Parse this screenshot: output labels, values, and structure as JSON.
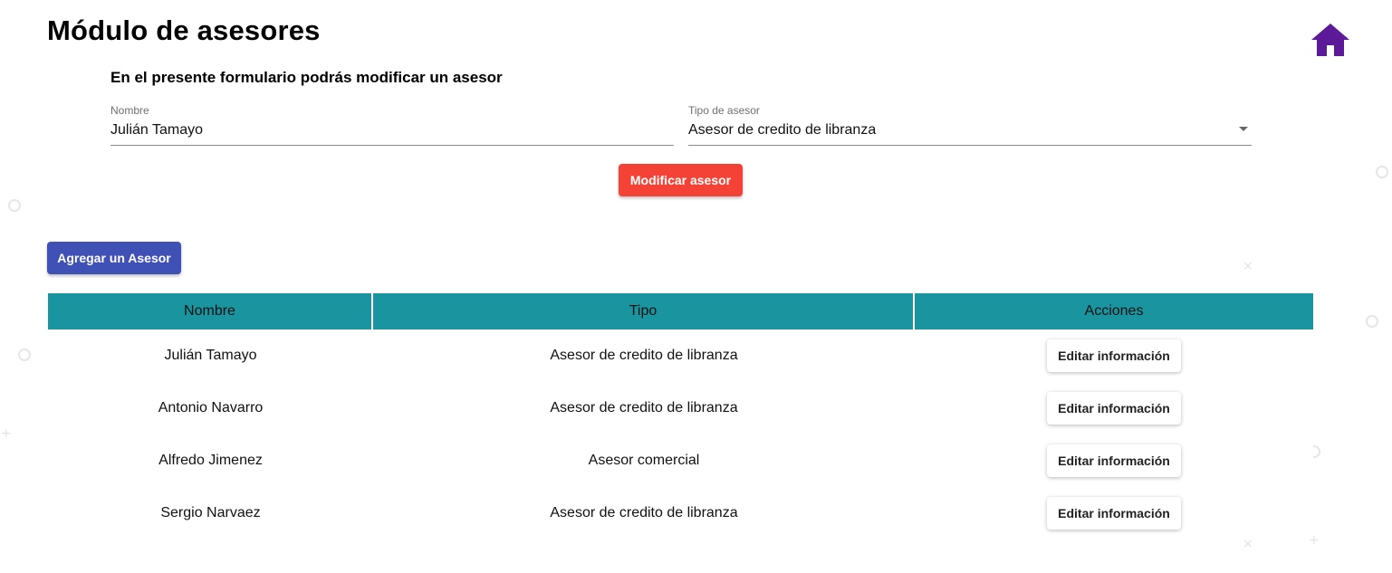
{
  "page": {
    "title": "Módulo de asesores"
  },
  "form": {
    "heading": "En el presente formulario podrás modificar un asesor",
    "name_label": "Nombre",
    "name_value": "Julián Tamayo",
    "type_label": "Tipo de asesor",
    "type_value": "Asesor de credito de libranza",
    "submit_label": "Modificar asesor"
  },
  "toolbar": {
    "add_label": "Agregar un Asesor"
  },
  "table": {
    "headers": [
      "Nombre",
      "Tipo",
      "Acciones"
    ],
    "rows": [
      {
        "name": "Julián Tamayo",
        "type": "Asesor de credito de libranza",
        "action": "Editar información"
      },
      {
        "name": "Antonio Navarro",
        "type": "Asesor de credito de libranza",
        "action": "Editar información"
      },
      {
        "name": "Alfredo Jimenez",
        "type": "Asesor comercial",
        "action": "Editar información"
      },
      {
        "name": "Sergio Narvaez",
        "type": "Asesor de credito de libranza",
        "action": "Editar información"
      }
    ]
  },
  "icons": {
    "home": "home-icon",
    "dropdown": "chevron-down-icon"
  },
  "colors": {
    "home_icon": "#5c1a99",
    "modify_button": "#f44336",
    "add_button": "#3f51b5",
    "table_header": "#1a95a0"
  }
}
